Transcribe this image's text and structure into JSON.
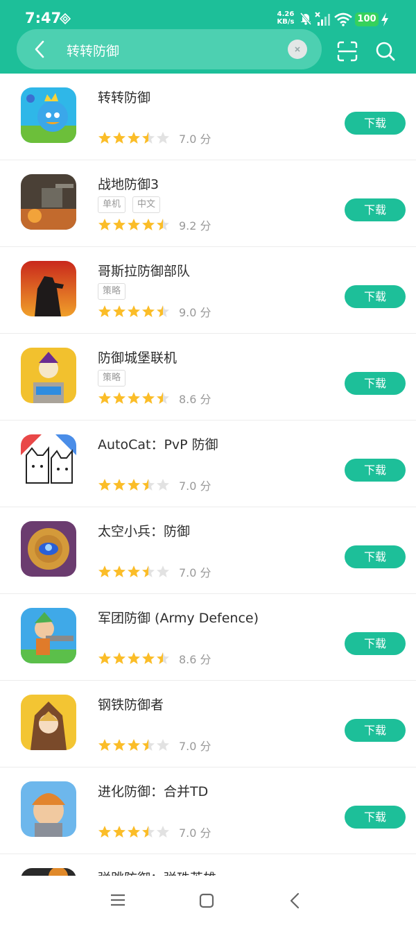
{
  "status_bar": {
    "time": "7:47",
    "net_speed_value": "4.26",
    "net_speed_unit": "KB/s",
    "battery": "100"
  },
  "search": {
    "query": "转转防御"
  },
  "download_label": "下载",
  "colors": {
    "accent": "#1dbf99",
    "star": "#fbbd28",
    "star_empty": "#e2e2e2"
  },
  "apps": [
    {
      "title": "转转防御",
      "tags": [],
      "stars": 3.5,
      "score": "7.0 分"
    },
    {
      "title": "战地防御3",
      "tags": [
        "单机",
        "中文"
      ],
      "stars": 4.5,
      "score": "9.2 分"
    },
    {
      "title": "哥斯拉防御部队",
      "tags": [
        "策略"
      ],
      "stars": 4.5,
      "score": "9.0 分"
    },
    {
      "title": "防御城堡联机",
      "tags": [
        "策略"
      ],
      "stars": 4.5,
      "score": "8.6 分"
    },
    {
      "title": "AutoCat：PvP 防御",
      "tags": [],
      "stars": 3.5,
      "score": "7.0 分"
    },
    {
      "title": "太空小兵：防御",
      "tags": [],
      "stars": 3.5,
      "score": "7.0 分"
    },
    {
      "title": "军团防御 (Army Defence)",
      "tags": [],
      "stars": 4.5,
      "score": "8.6 分"
    },
    {
      "title": "钢铁防御者",
      "tags": [],
      "stars": 3.5,
      "score": "7.0 分"
    },
    {
      "title": "进化防御：合并TD",
      "tags": [],
      "stars": 3.5,
      "score": "7.0 分"
    }
  ],
  "partial_app": {
    "title": "弹跳防御：弹珠英雄"
  }
}
